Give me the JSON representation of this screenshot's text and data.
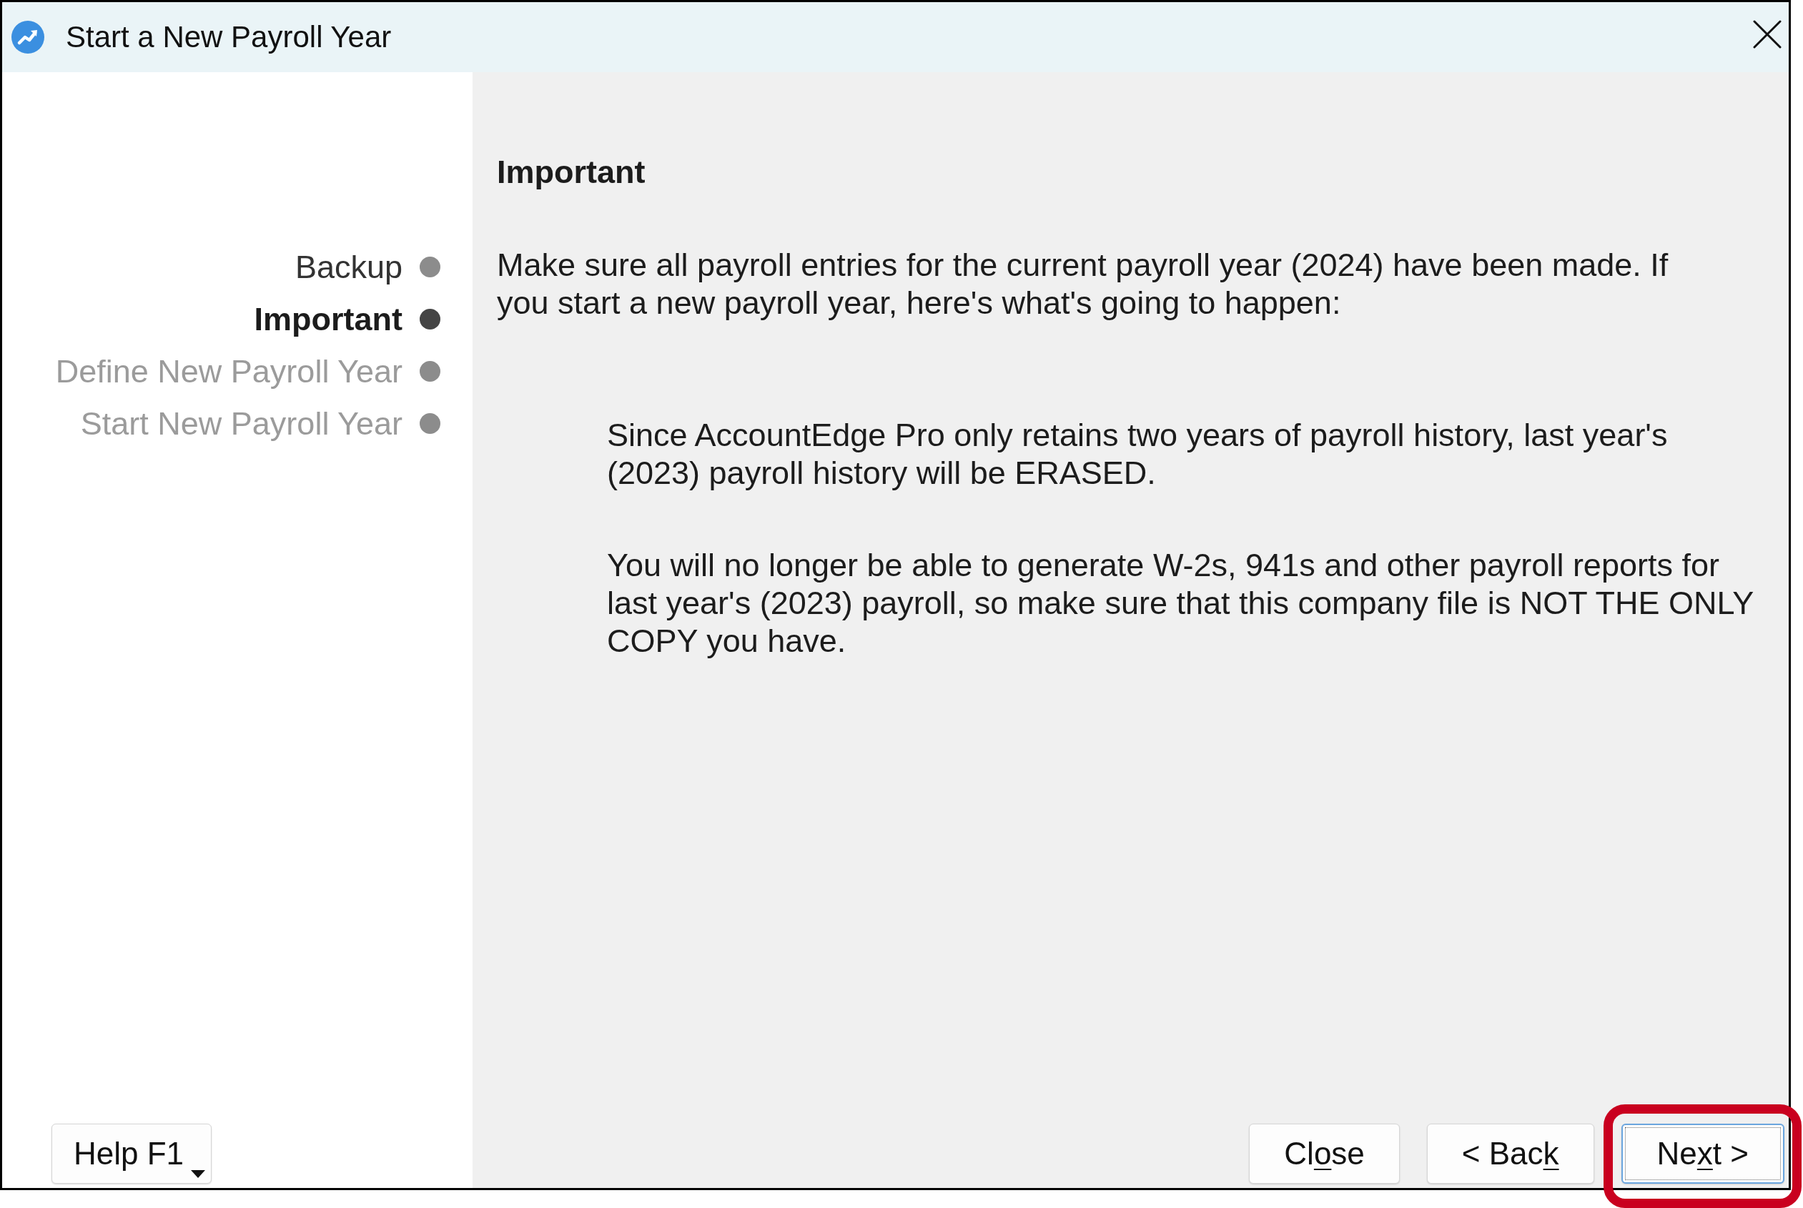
{
  "window": {
    "title": "Start a New Payroll Year"
  },
  "steps": [
    {
      "label": "Backup",
      "selected": false,
      "disabled": false
    },
    {
      "label": "Important",
      "selected": true,
      "disabled": false
    },
    {
      "label": "Define New Payroll Year",
      "selected": false,
      "disabled": true
    },
    {
      "label": "Start New Payroll Year",
      "selected": false,
      "disabled": true
    }
  ],
  "content": {
    "heading": "Important",
    "intro": "Make sure all payroll entries for the current payroll year (2024) have been made. If you start a new payroll year, here's what's going to happen:",
    "notes": [
      "Since AccountEdge Pro only retains two years of payroll history, last year's (2023) payroll history will be ERASED.",
      "You will no longer be able to generate W-2s, 941s and other payroll reports for last year's (2023) payroll, so make sure that this company file is NOT THE ONLY COPY you have."
    ]
  },
  "help_button": {
    "label": "Help F1"
  },
  "buttons": [
    {
      "label_start": "Cl",
      "access_key": "o",
      "label_end": "se",
      "focused": false,
      "highlighted": false
    },
    {
      "label_start": "< Bac",
      "access_key": "k",
      "focused": false,
      "highlighted": false
    },
    {
      "label_start": "Ne",
      "access_key": "x",
      "label_end": "t >",
      "focused": true,
      "highlighted": true
    }
  ]
}
